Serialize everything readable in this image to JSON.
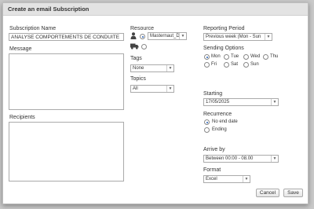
{
  "dialog": {
    "title": "Create an email Subscription"
  },
  "left": {
    "subscription_name_label": "Subscription Name",
    "subscription_name_value": "ANALYSE COMPORTEMENTS DE CONDUITE",
    "message_label": "Message",
    "recipients_label": "Recipients"
  },
  "middle": {
    "resource_label": "Resource",
    "resource_selected": "Masternaut_Der",
    "tags_label": "Tags",
    "tags_value": "None",
    "topics_label": "Topics",
    "topics_value": "All"
  },
  "right": {
    "reporting_period_label": "Reporting Period",
    "reporting_period_value": "Previous week (Mon - Sun",
    "sending_options_label": "Sending Options",
    "days": [
      "Mon",
      "Tue",
      "Wed",
      "Thu",
      "Fri",
      "Sat",
      "Sun"
    ],
    "selected_day": "Mon",
    "starting_label": "Starting",
    "starting_value": "17/05/2025",
    "recurrence_label": "Recurrence",
    "recurrence_options": [
      "No end date",
      "Ending"
    ],
    "arrive_by_label": "Arrive by",
    "arrive_by_value": "Between 00:00 - 08.00",
    "format_label": "Format",
    "format_value": "Excel"
  },
  "buttons": {
    "cancel": "Cancel",
    "save": "Save"
  },
  "colors": {
    "accent": "#2a62b8",
    "titlebar": "#e3e3e3"
  }
}
